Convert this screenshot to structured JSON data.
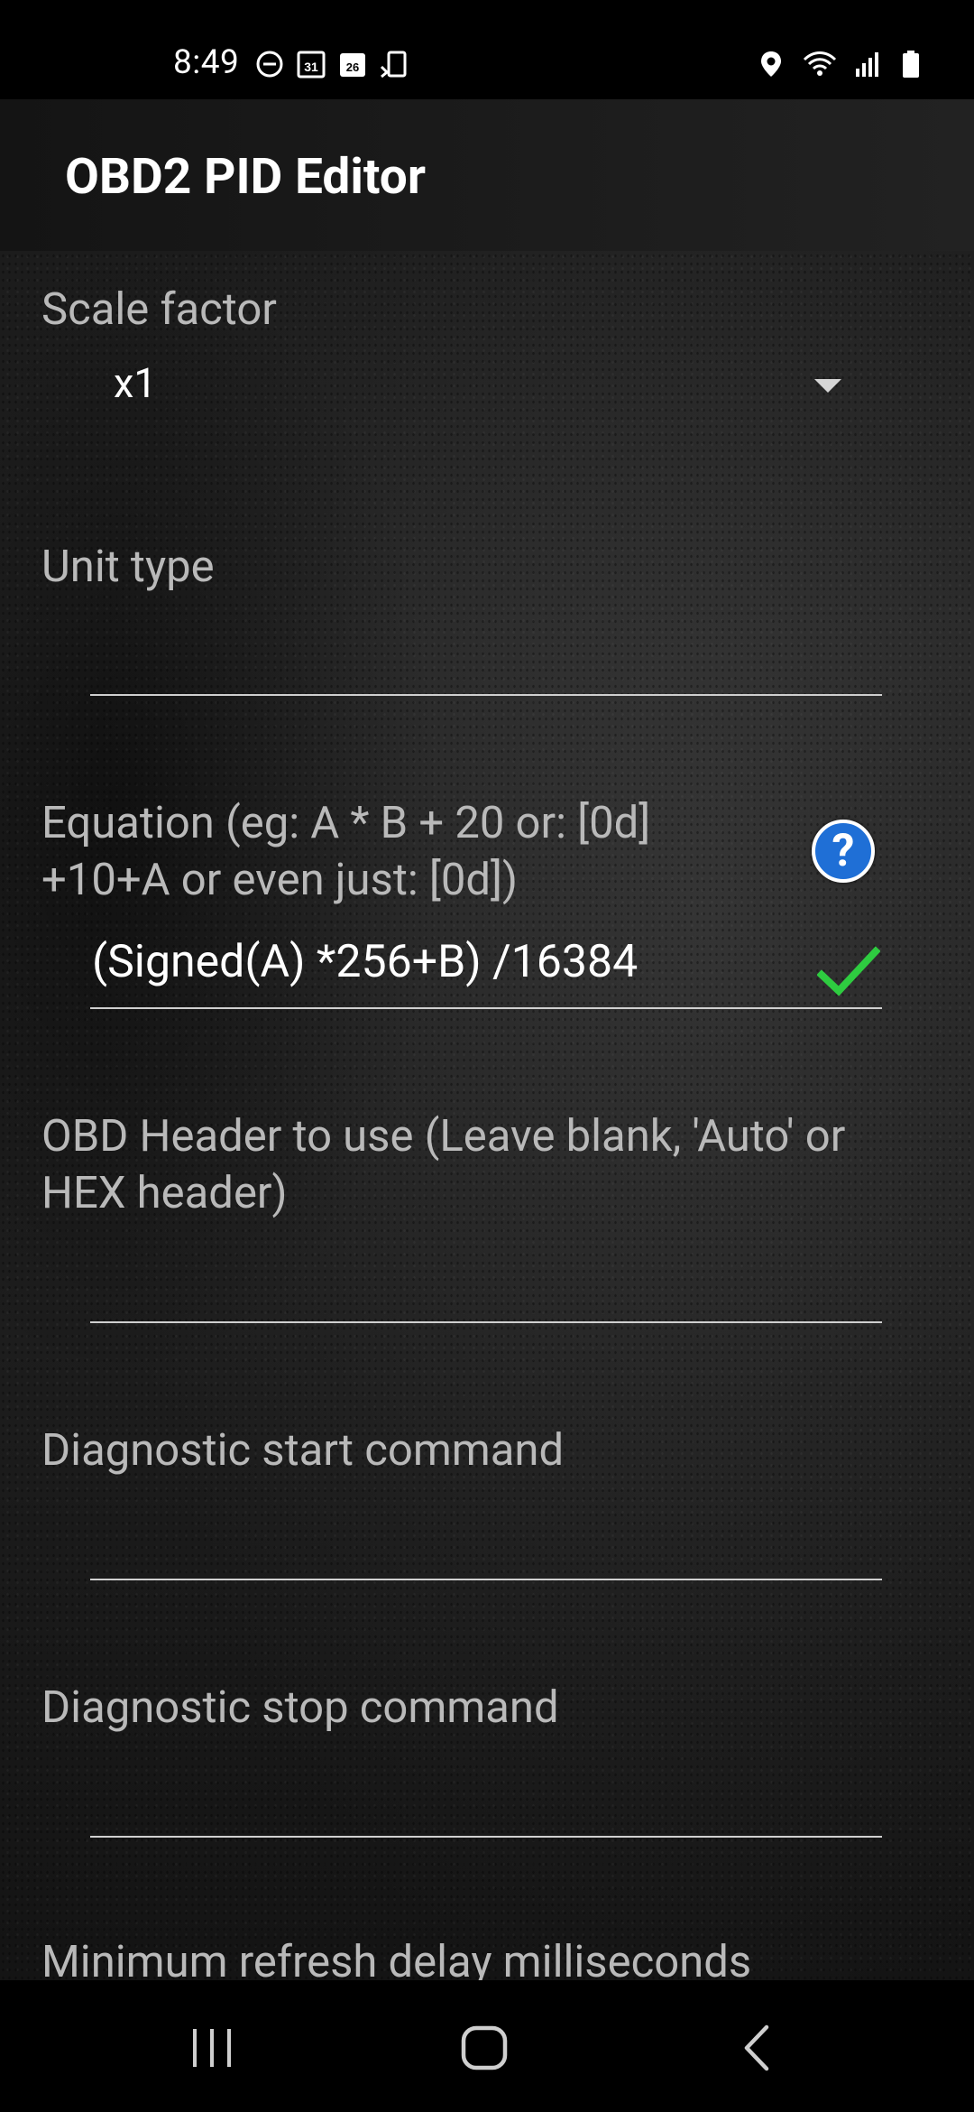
{
  "status_bar": {
    "time": "8:49",
    "left_icons": [
      "do-not-disturb-icon",
      "calendar-31-icon",
      "calendar-26-icon",
      "screen-rotate-icon"
    ],
    "right_icons": [
      "location-icon",
      "wifi-icon",
      "signal-icon",
      "battery-icon"
    ]
  },
  "app_bar": {
    "title": "OBD2 PID Editor"
  },
  "form": {
    "scale_factor": {
      "label": "Scale factor",
      "selected": "x1"
    },
    "unit_type": {
      "label": "Unit type",
      "value": ""
    },
    "equation": {
      "label_line1": "Equation (eg:  A * B + 20   or: [0d]",
      "label_line2": "+10+A  or even just: [0d])",
      "value": "(Signed(A) *256+B) /16384",
      "help_glyph": "?",
      "valid_color": "#2ecc40"
    },
    "obd_header": {
      "label_line1": "OBD Header to use (Leave blank, 'Auto' or",
      "label_line2": "HEX header)",
      "value": ""
    },
    "diag_start": {
      "label": "Diagnostic start command",
      "value": ""
    },
    "diag_stop": {
      "label": "Diagnostic stop command",
      "value": ""
    },
    "min_refresh": {
      "label": "Minimum refresh delay milliseconds"
    }
  },
  "nav_bar": {
    "buttons": [
      "recents-icon",
      "home-icon",
      "back-icon"
    ]
  }
}
